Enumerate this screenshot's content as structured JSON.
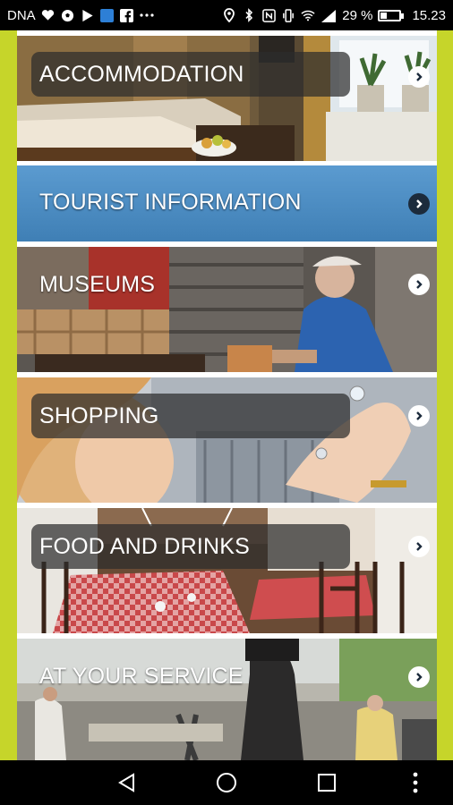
{
  "status_bar": {
    "carrier": "DNA",
    "battery_percent_text": "29 %",
    "battery_level": 0.29,
    "time": "15.23",
    "left_icons": [
      "heart-icon",
      "soccer-ball-icon",
      "play-store-icon",
      "app-icon-blue",
      "facebook-icon",
      "more-dots-icon"
    ],
    "right_icons": [
      "location-icon",
      "bluetooth-icon",
      "nfc-icon",
      "vibrate-icon",
      "wifi-icon",
      "signal-icon"
    ]
  },
  "menu": {
    "items": [
      {
        "label": "ACCOMMODATION",
        "style": "pill"
      },
      {
        "label": "TOURIST INFORMATION",
        "style": "banner"
      },
      {
        "label": "MUSEUMS",
        "style": "plain"
      },
      {
        "label": "SHOPPING",
        "style": "pill"
      },
      {
        "label": "FOOD AND DRINKS",
        "style": "pill"
      },
      {
        "label": "AT YOUR SERVICE",
        "style": "plain"
      }
    ]
  },
  "colors": {
    "accent_green": "#c6d52a",
    "banner_blue": "#4a8dc4",
    "chevron_dark": "#1c2b3c"
  },
  "nav_bar": {
    "buttons": [
      "back-icon",
      "home-icon",
      "recents-icon",
      "overflow-menu-icon"
    ]
  }
}
